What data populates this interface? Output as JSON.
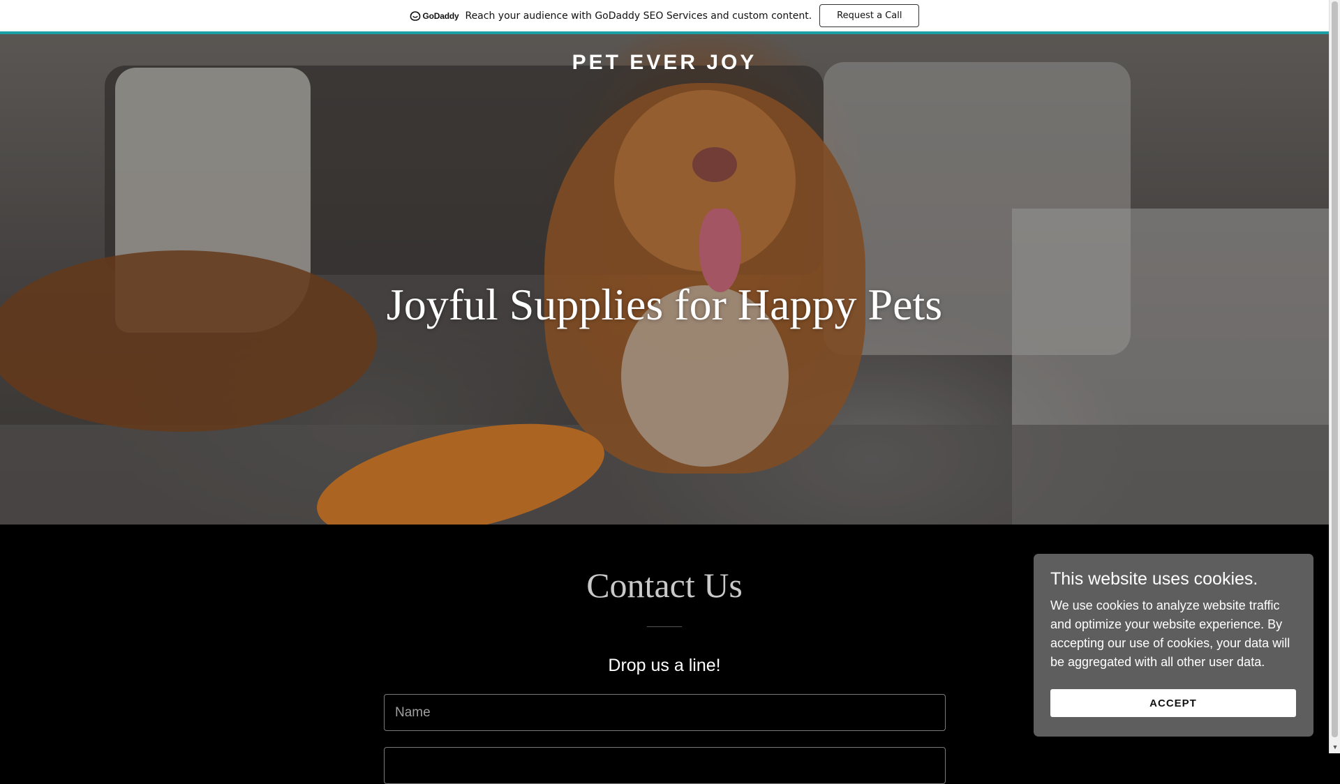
{
  "promo_bar": {
    "logo_text": "GoDaddy",
    "message": "Reach your audience with GoDaddy SEO Services and custom content.",
    "cta_label": "Request a Call",
    "accent_color": "#1ba0a6"
  },
  "hero": {
    "brand_name": "PET EVER JOY",
    "headline": "Joyful Supplies for Happy Pets"
  },
  "contact": {
    "title": "Contact Us",
    "subtitle": "Drop us a line!",
    "fields": {
      "name_placeholder": "Name",
      "email_placeholder": ""
    }
  },
  "cookie_banner": {
    "title": "This website uses cookies.",
    "body": "We use cookies to analyze website traffic and optimize your website experience. By accepting our use of cookies, your data will be aggregated with all other user data.",
    "accept_label": "ACCEPT"
  }
}
